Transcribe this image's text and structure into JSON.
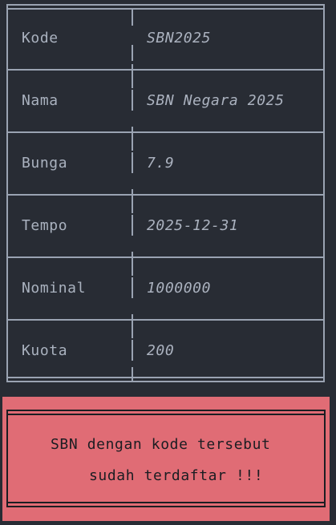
{
  "table": {
    "rows": [
      {
        "label": "Kode",
        "value": "SBN2025"
      },
      {
        "label": "Nama",
        "value": "SBN Negara 2025"
      },
      {
        "label": "Bunga",
        "value": "7.9"
      },
      {
        "label": "Tempo",
        "value": "2025-12-31"
      },
      {
        "label": "Nominal",
        "value": "1000000"
      },
      {
        "label": "Kuota",
        "value": "200"
      }
    ]
  },
  "alert": {
    "line1": "SBN dengan kode tersebut",
    "line2": "sudah terdaftar !!!"
  },
  "colors": {
    "background": "#282c34",
    "table_border": "#9aa3b2",
    "text": "#abb2bf",
    "alert_background": "#e06c75",
    "alert_text": "#1b1d22"
  }
}
